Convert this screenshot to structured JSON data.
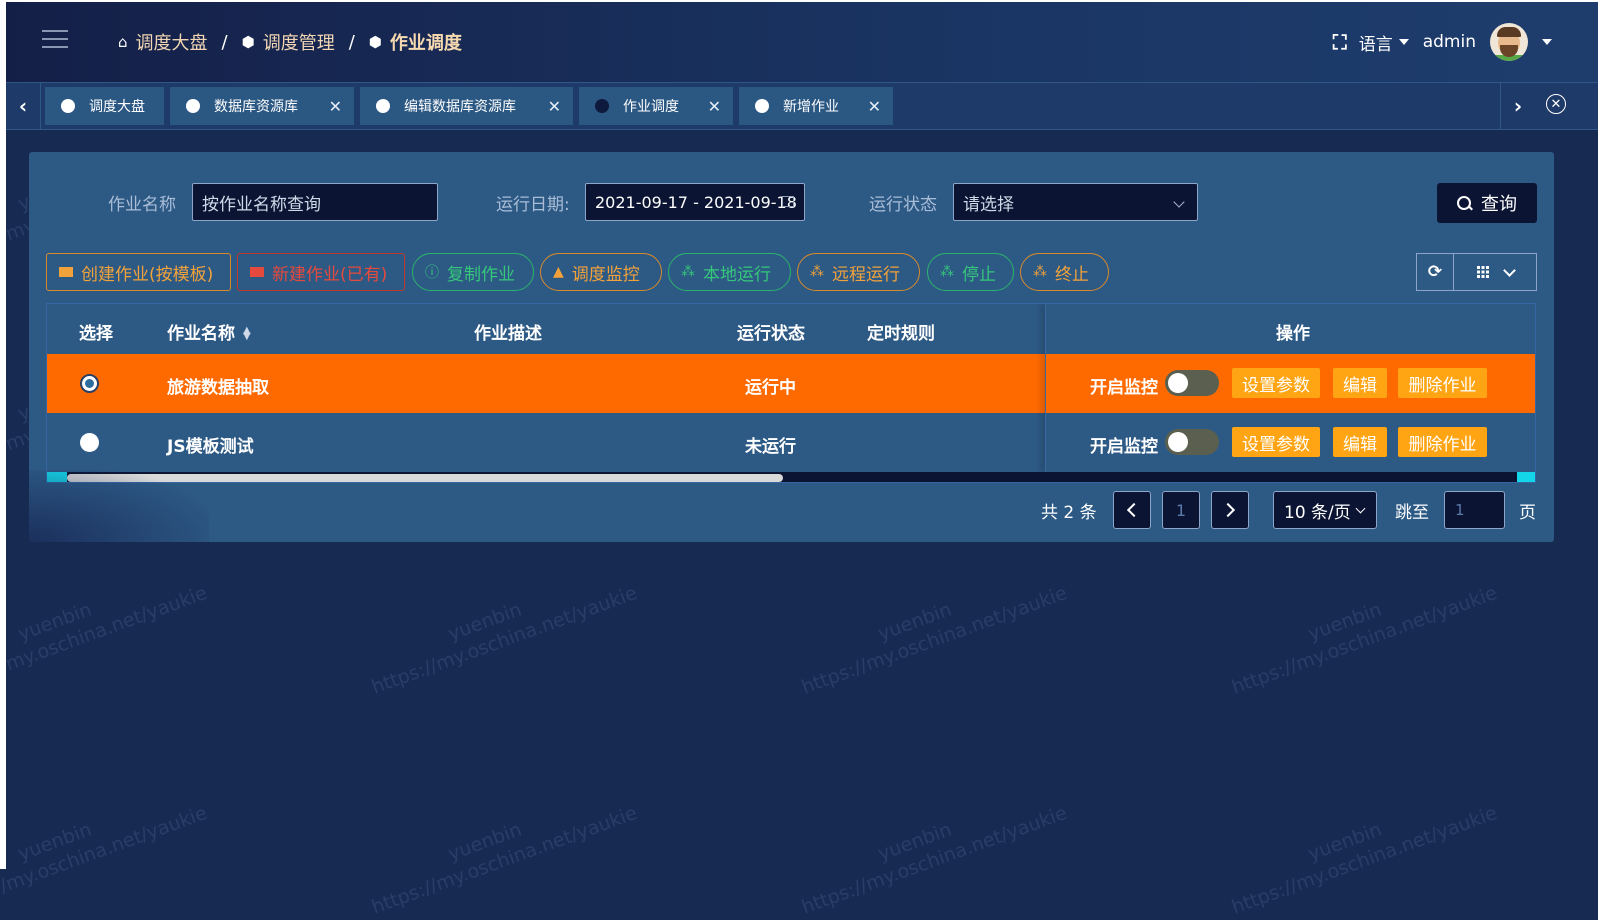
{
  "header": {
    "breadcrumbs": [
      {
        "label": "调度大盘",
        "icon": "home-icon"
      },
      {
        "label": "调度管理",
        "icon": "cube-icon"
      },
      {
        "label": "作业调度",
        "icon": "cube-icon"
      }
    ],
    "separator": "/",
    "language_label": "语言",
    "username": "admin"
  },
  "tabs": [
    {
      "label": "调度大盘",
      "closable": false,
      "active": false
    },
    {
      "label": "数据库资源库",
      "closable": true,
      "active": false
    },
    {
      "label": "编辑数据库资源库",
      "closable": true,
      "active": false
    },
    {
      "label": "作业调度",
      "closable": true,
      "active": true
    },
    {
      "label": "新增作业",
      "closable": true,
      "active": false
    }
  ],
  "search": {
    "job_name_label": "作业名称",
    "job_name_placeholder": "按作业名称查询",
    "run_date_label": "运行日期:",
    "run_date_value": "2021-09-17 - 2021-09-18",
    "run_status_label": "运行状态",
    "run_status_placeholder": "请选择",
    "query_label": "查询"
  },
  "actions": [
    {
      "label": "创建作业(按模板)",
      "icon": "card-icon",
      "color": "#f2a23a"
    },
    {
      "label": "新建作业(已有)",
      "icon": "card-icon",
      "color": "#e54a3d"
    },
    {
      "label": "复制作业",
      "icon": "info-circle-icon",
      "color": "#35c77a"
    },
    {
      "label": "调度监控",
      "icon": "bell-icon",
      "color": "#f2a23a"
    },
    {
      "label": "本地运行",
      "icon": "cluster-icon",
      "color": "#35c77a"
    },
    {
      "label": "远程运行",
      "icon": "cluster-icon",
      "color": "#f2a23a"
    },
    {
      "label": "停止",
      "icon": "cluster-icon",
      "color": "#35c77a"
    },
    {
      "label": "终止",
      "icon": "cluster-icon",
      "color": "#f2a23a"
    }
  ],
  "table": {
    "headers": {
      "select": "选择",
      "name": "作业名称",
      "desc": "作业描述",
      "status": "运行状态",
      "schedule": "定时规则",
      "ops": "操作"
    },
    "rows": [
      {
        "selected": true,
        "name": "旅游数据抽取",
        "desc": "",
        "status": "运行中",
        "schedule": "",
        "monitor_label": "开启监控",
        "monitor_on": false,
        "set_params": "设置参数",
        "edit": "编辑",
        "delete": "删除作业"
      },
      {
        "selected": false,
        "name": "JS模板测试",
        "desc": "",
        "status": "未运行",
        "schedule": "",
        "monitor_label": "开启监控",
        "monitor_on": false,
        "set_params": "设置参数",
        "edit": "编辑",
        "delete": "删除作业"
      }
    ],
    "highlight_color": "#ff6a00"
  },
  "pagination": {
    "total_text": "共 2 条",
    "current_page": "1",
    "page_size": "10 条/页",
    "jump_label": "跳至",
    "jump_value": "1",
    "page_suffix": "页"
  },
  "watermark": {
    "name": "yuenbin",
    "url": "https://my.oschina.net/yaukie"
  }
}
